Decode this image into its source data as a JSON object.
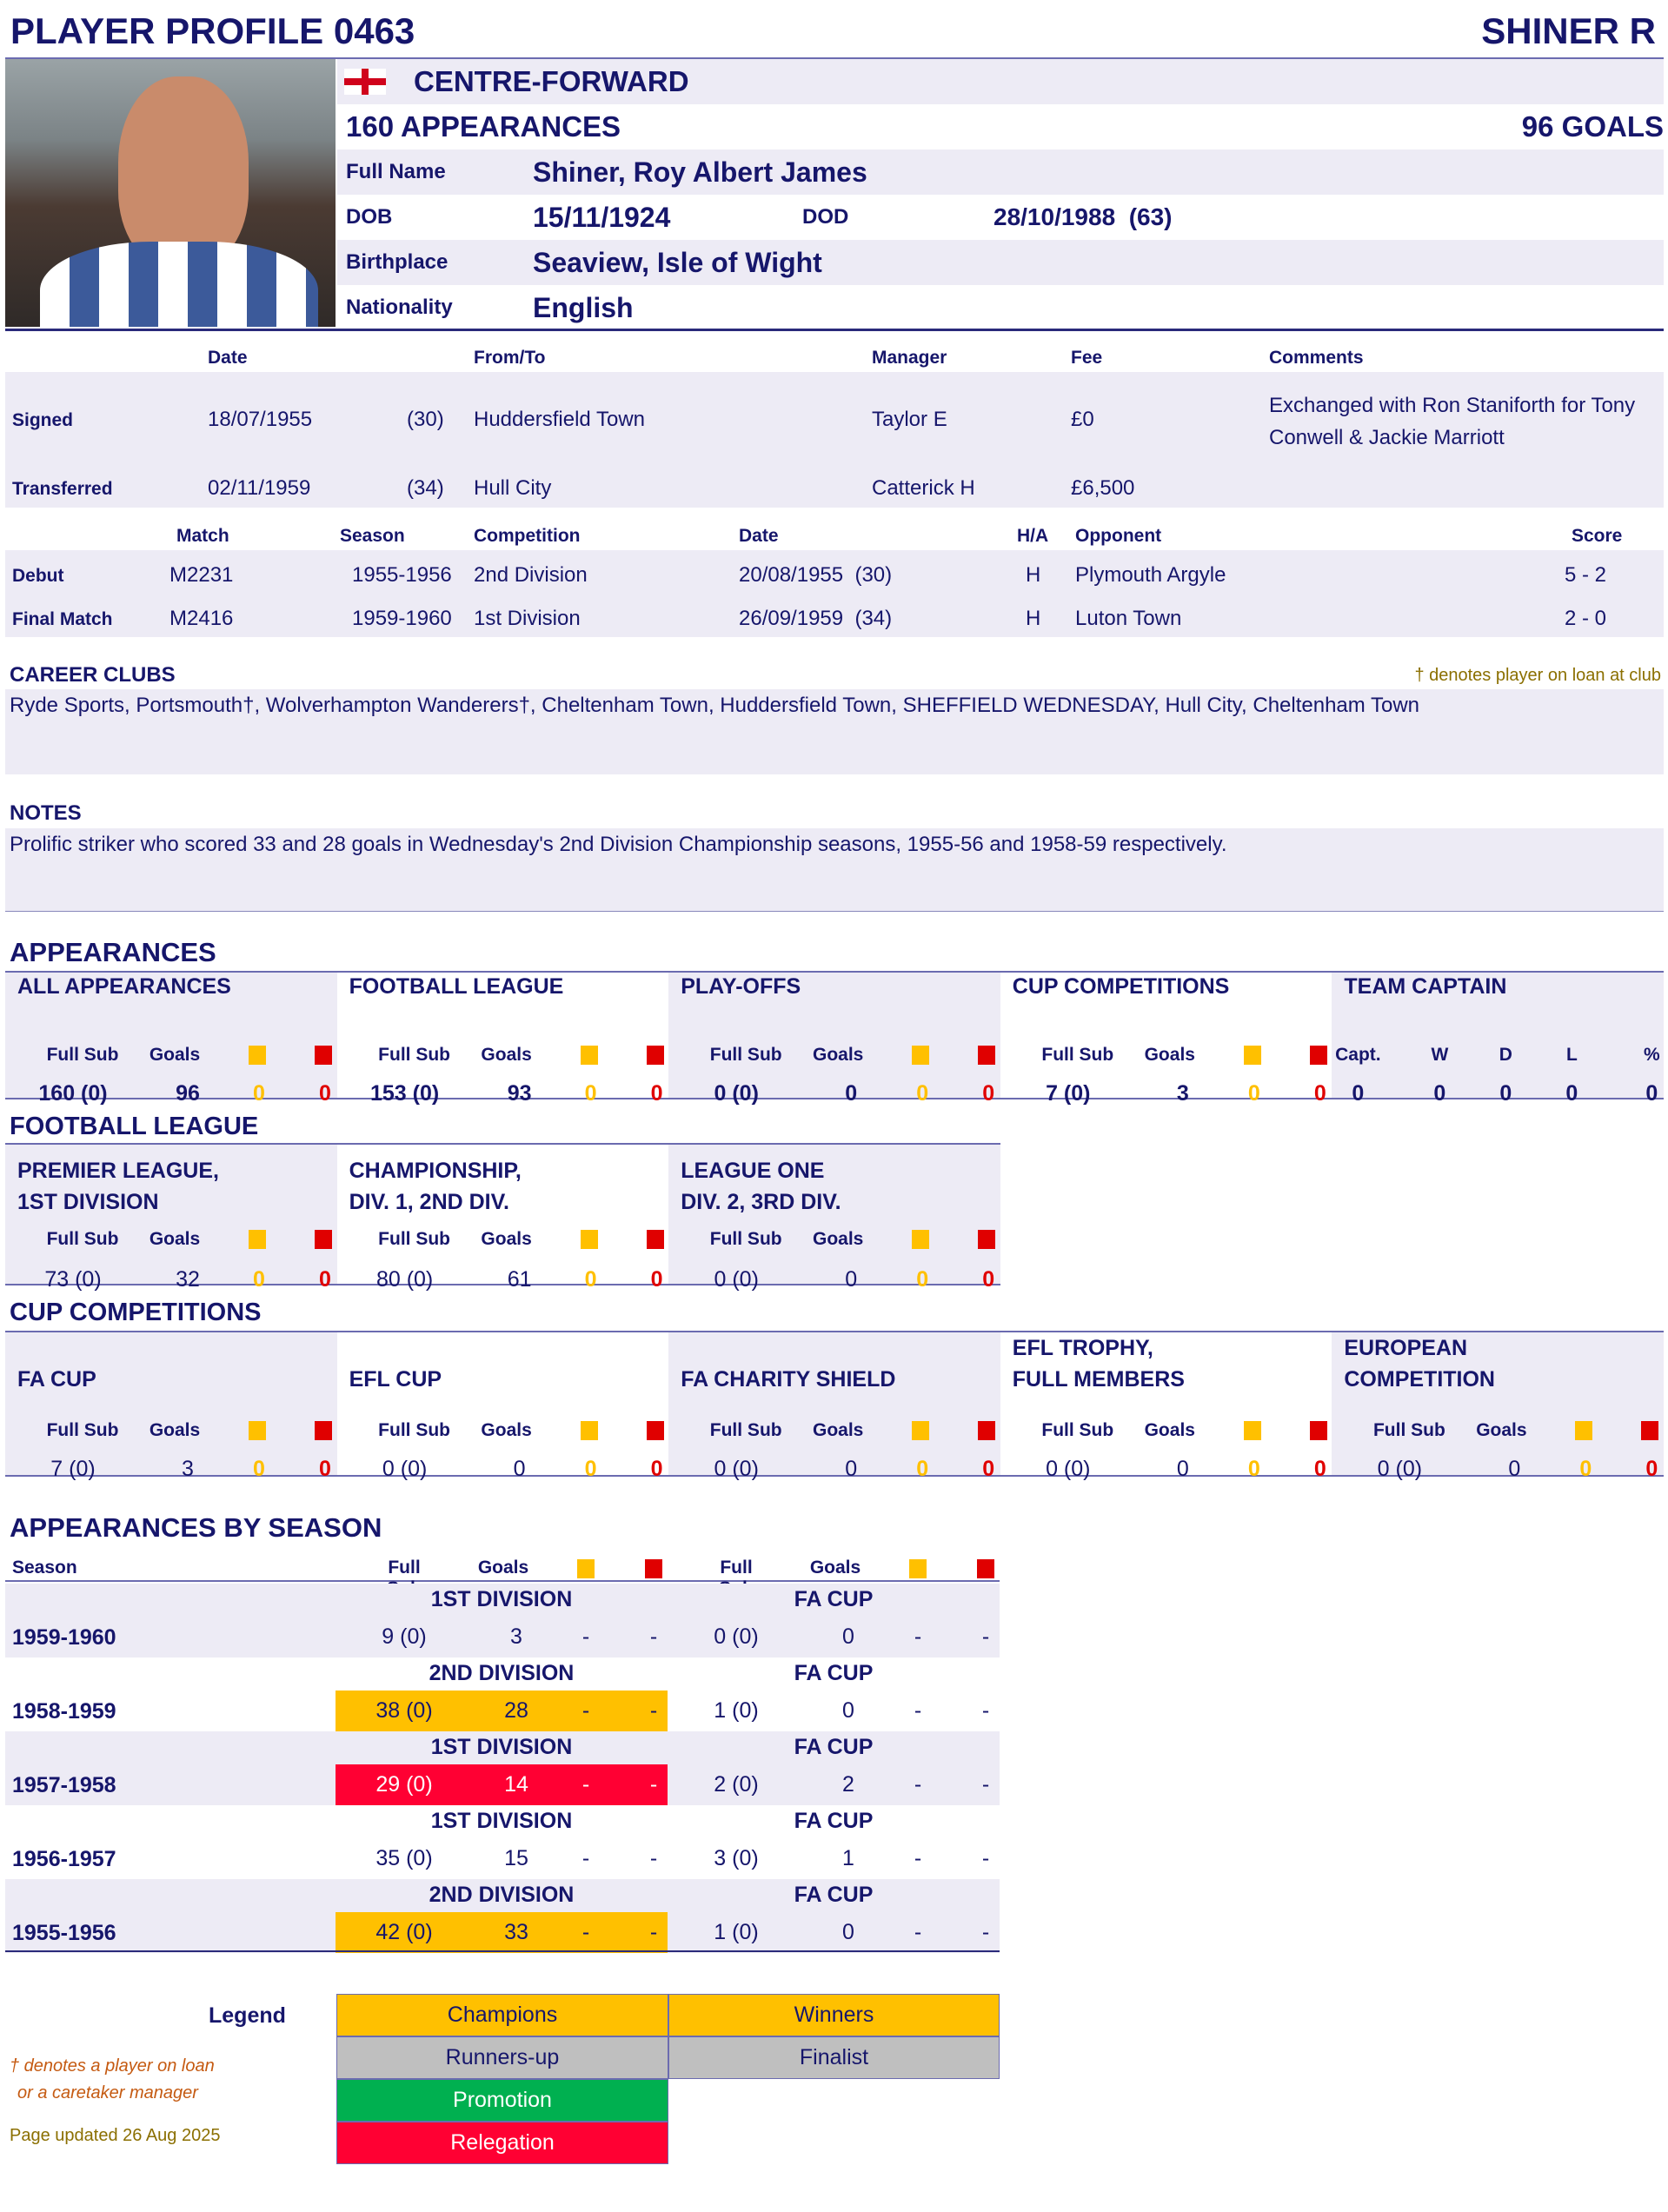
{
  "header": {
    "profile_title": "PLAYER PROFILE 0463",
    "player_short": "SHINER R"
  },
  "profile": {
    "position": "CENTRE-FORWARD",
    "flag_icon": "england-flag-icon",
    "appearances": "160 APPEARANCES",
    "goals": "96 GOALS",
    "full_name_label": "Full Name",
    "full_name": "Shiner, Roy Albert James",
    "dob_label": "DOB",
    "dob": "15/11/1924",
    "dod_label": "DOD",
    "dod": "28/10/1988  (63)",
    "birthplace_label": "Birthplace",
    "birthplace": "Seaview, Isle of Wight",
    "nationality_label": "Nationality",
    "nationality": "English"
  },
  "transfers": {
    "headers": {
      "date": "Date",
      "from_to": "From/To",
      "manager": "Manager",
      "fee": "Fee",
      "comments": "Comments"
    },
    "rows": [
      {
        "type": "Signed",
        "date": "18/07/1955",
        "age": "(30)",
        "club": "Huddersfield Town",
        "manager": "Taylor E",
        "fee": "£0",
        "comments": "Exchanged with Ron Staniforth for Tony Conwell & Jackie Marriott"
      },
      {
        "type": "Transferred",
        "date": "02/11/1959",
        "age": "(34)",
        "club": "Hull City",
        "manager": "Catterick H",
        "fee": "£6,500",
        "comments": ""
      }
    ]
  },
  "matches": {
    "headers": {
      "match": "Match",
      "season": "Season",
      "competition": "Competition",
      "date": "Date",
      "ha": "H/A",
      "opponent": "Opponent",
      "score": "Score"
    },
    "rows": [
      {
        "type": "Debut",
        "match": "M2231",
        "season": "1955-1956",
        "competition": "2nd Division",
        "date": "20/08/1955  (30)",
        "ha": "H",
        "opponent": "Plymouth Argyle",
        "score": "5 - 2"
      },
      {
        "type": "Final Match",
        "match": "M2416",
        "season": "1959-1960",
        "competition": "1st Division",
        "date": "26/09/1959  (34)",
        "ha": "H",
        "opponent": "Luton Town",
        "score": "2 - 0"
      }
    ]
  },
  "career": {
    "title": "CAREER CLUBS",
    "loan_note": "† denotes player on loan at club",
    "clubs": "Ryde Sports, Portsmouth†, Wolverhampton Wanderers†, Cheltenham Town, Huddersfield Town, SHEFFIELD WEDNESDAY, Hull City, Cheltenham Town"
  },
  "notes": {
    "title": "NOTES",
    "text": "Prolific striker who scored 33 and 28 goals in Wednesday's 2nd Division Championship seasons, 1955-56 and 1958-59 respectively."
  },
  "labels": {
    "full_sub": "Full Sub",
    "goals": "Goals",
    "season": "Season"
  },
  "appearances": {
    "title": "APPEARANCES",
    "blocks": [
      {
        "title": "ALL APPEARANCES",
        "apps": "160 (0)",
        "goals": "96",
        "yellow": "0",
        "red": "0"
      },
      {
        "title": "FOOTBALL LEAGUE",
        "apps": "153 (0)",
        "goals": "93",
        "yellow": "0",
        "red": "0"
      },
      {
        "title": "PLAY-OFFS",
        "apps": "0 (0)",
        "goals": "0",
        "yellow": "0",
        "red": "0"
      },
      {
        "title": "CUP COMPETITIONS",
        "apps": "7 (0)",
        "goals": "3",
        "yellow": "0",
        "red": "0"
      }
    ],
    "captain": {
      "title": "TEAM CAPTAIN",
      "headers": [
        "Capt.",
        "W",
        "D",
        "L",
        "%"
      ],
      "values": [
        "0",
        "0",
        "0",
        "0",
        "0"
      ]
    }
  },
  "football_league": {
    "title": "FOOTBALL LEAGUE",
    "blocks": [
      {
        "title": "PREMIER LEAGUE,\n1ST DIVISION",
        "apps": "73 (0)",
        "goals": "32",
        "yellow": "0",
        "red": "0"
      },
      {
        "title": "CHAMPIONSHIP,\nDIV. 1, 2ND DIV.",
        "apps": "80 (0)",
        "goals": "61",
        "yellow": "0",
        "red": "0"
      },
      {
        "title": "LEAGUE ONE\nDIV. 2, 3RD DIV.",
        "apps": "0 (0)",
        "goals": "0",
        "yellow": "0",
        "red": "0"
      }
    ]
  },
  "cup_competitions": {
    "title": "CUP COMPETITIONS",
    "blocks": [
      {
        "title": "FA CUP",
        "apps": "7 (0)",
        "goals": "3",
        "yellow": "0",
        "red": "0"
      },
      {
        "title": "EFL CUP",
        "apps": "0 (0)",
        "goals": "0",
        "yellow": "0",
        "red": "0"
      },
      {
        "title": "FA CHARITY SHIELD",
        "apps": "0 (0)",
        "goals": "0",
        "yellow": "0",
        "red": "0"
      },
      {
        "title": "EFL TROPHY,\nFULL MEMBERS",
        "apps": "0 (0)",
        "goals": "0",
        "yellow": "0",
        "red": "0"
      },
      {
        "title": "EUROPEAN\nCOMPETITION",
        "apps": "0 (0)",
        "goals": "0",
        "yellow": "0",
        "red": "0"
      }
    ]
  },
  "by_season": {
    "title": "APPEARANCES BY SEASON",
    "rows": [
      {
        "season": "1959-1960",
        "league": {
          "comp": "1ST DIVISION",
          "apps": "9 (0)",
          "goals": "3",
          "yellow": "-",
          "red": "-",
          "status": ""
        },
        "cup": {
          "comp": "FA CUP",
          "apps": "0 (0)",
          "goals": "0",
          "yellow": "-",
          "red": "-"
        }
      },
      {
        "season": "1958-1959",
        "league": {
          "comp": "2ND DIVISION",
          "apps": "38 (0)",
          "goals": "28",
          "yellow": "-",
          "red": "-",
          "status": "champions"
        },
        "cup": {
          "comp": "FA CUP",
          "apps": "1 (0)",
          "goals": "0",
          "yellow": "-",
          "red": "-"
        }
      },
      {
        "season": "1957-1958",
        "league": {
          "comp": "1ST DIVISION",
          "apps": "29 (0)",
          "goals": "14",
          "yellow": "-",
          "red": "-",
          "status": "relegation"
        },
        "cup": {
          "comp": "FA CUP",
          "apps": "2 (0)",
          "goals": "2",
          "yellow": "-",
          "red": "-"
        }
      },
      {
        "season": "1956-1957",
        "league": {
          "comp": "1ST DIVISION",
          "apps": "35 (0)",
          "goals": "15",
          "yellow": "-",
          "red": "-",
          "status": ""
        },
        "cup": {
          "comp": "FA CUP",
          "apps": "3 (0)",
          "goals": "1",
          "yellow": "-",
          "red": "-"
        }
      },
      {
        "season": "1955-1956",
        "league": {
          "comp": "2ND DIVISION",
          "apps": "42 (0)",
          "goals": "33",
          "yellow": "-",
          "red": "-",
          "status": "champions"
        },
        "cup": {
          "comp": "FA CUP",
          "apps": "1 (0)",
          "goals": "0",
          "yellow": "-",
          "red": "-"
        }
      }
    ]
  },
  "legend": {
    "title": "Legend",
    "champions": "Champions",
    "winners": "Winners",
    "runners_up": "Runners-up",
    "finalist": "Finalist",
    "promotion": "Promotion",
    "relegation": "Relegation",
    "footnote1": "† denotes a player on loan",
    "footnote2": "or a caretaker manager",
    "updated": "Page updated 26 Aug 2025"
  },
  "colors": {
    "navy": "#16166b",
    "lavender": "#edebf5",
    "yellow": "#ffc000",
    "red": "#e00000",
    "champions": "#ffc000",
    "runners_up": "#bfbfbf",
    "promotion": "#00b050",
    "relegation": "#ff0033"
  }
}
